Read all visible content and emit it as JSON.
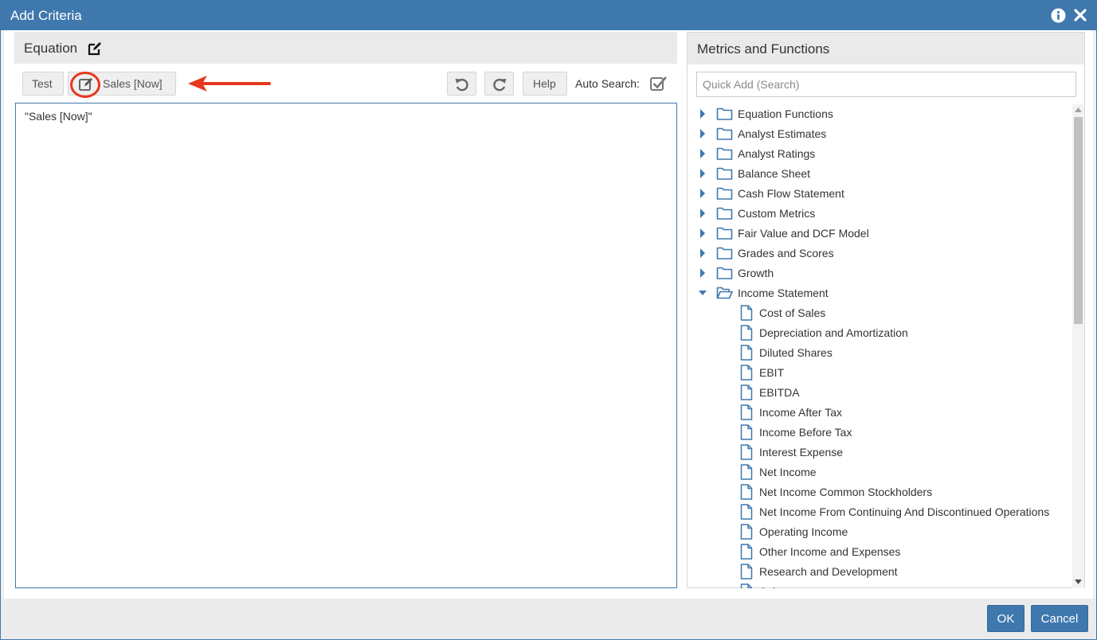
{
  "dialog": {
    "title": "Add Criteria"
  },
  "equation": {
    "header": "Equation",
    "test_label": "Test",
    "metric_button_label": "Sales [Now]",
    "help_label": "Help",
    "auto_search_label": "Auto Search:",
    "auto_search_checked": true,
    "editor_content": "\"Sales [Now]\"",
    "annotation_color": "#e8371f"
  },
  "metrics": {
    "header": "Metrics and Functions",
    "search_placeholder": "Quick Add (Search)",
    "folders": [
      {
        "label": "Equation Functions",
        "expanded": false
      },
      {
        "label": "Analyst Estimates",
        "expanded": false
      },
      {
        "label": "Analyst Ratings",
        "expanded": false
      },
      {
        "label": "Balance Sheet",
        "expanded": false
      },
      {
        "label": "Cash Flow Statement",
        "expanded": false
      },
      {
        "label": "Custom Metrics",
        "expanded": false
      },
      {
        "label": "Fair Value and DCF Model",
        "expanded": false
      },
      {
        "label": "Grades and Scores",
        "expanded": false
      },
      {
        "label": "Growth",
        "expanded": false
      },
      {
        "label": "Income Statement",
        "expanded": true
      }
    ],
    "income_statement_items": [
      "Cost of Sales",
      "Depreciation and Amortization",
      "Diluted Shares",
      "EBIT",
      "EBITDA",
      "Income After Tax",
      "Income Before Tax",
      "Interest Expense",
      "Net Income",
      "Net Income Common Stockholders",
      "Net Income From Continuing And Discontinued Operations",
      "Operating Income",
      "Other Income and Expenses",
      "Research and Development",
      "Sales"
    ]
  },
  "footer": {
    "ok_label": "OK",
    "cancel_label": "Cancel"
  },
  "colors": {
    "accent": "#3f78ad",
    "icon_blue": "#3f78ad"
  }
}
